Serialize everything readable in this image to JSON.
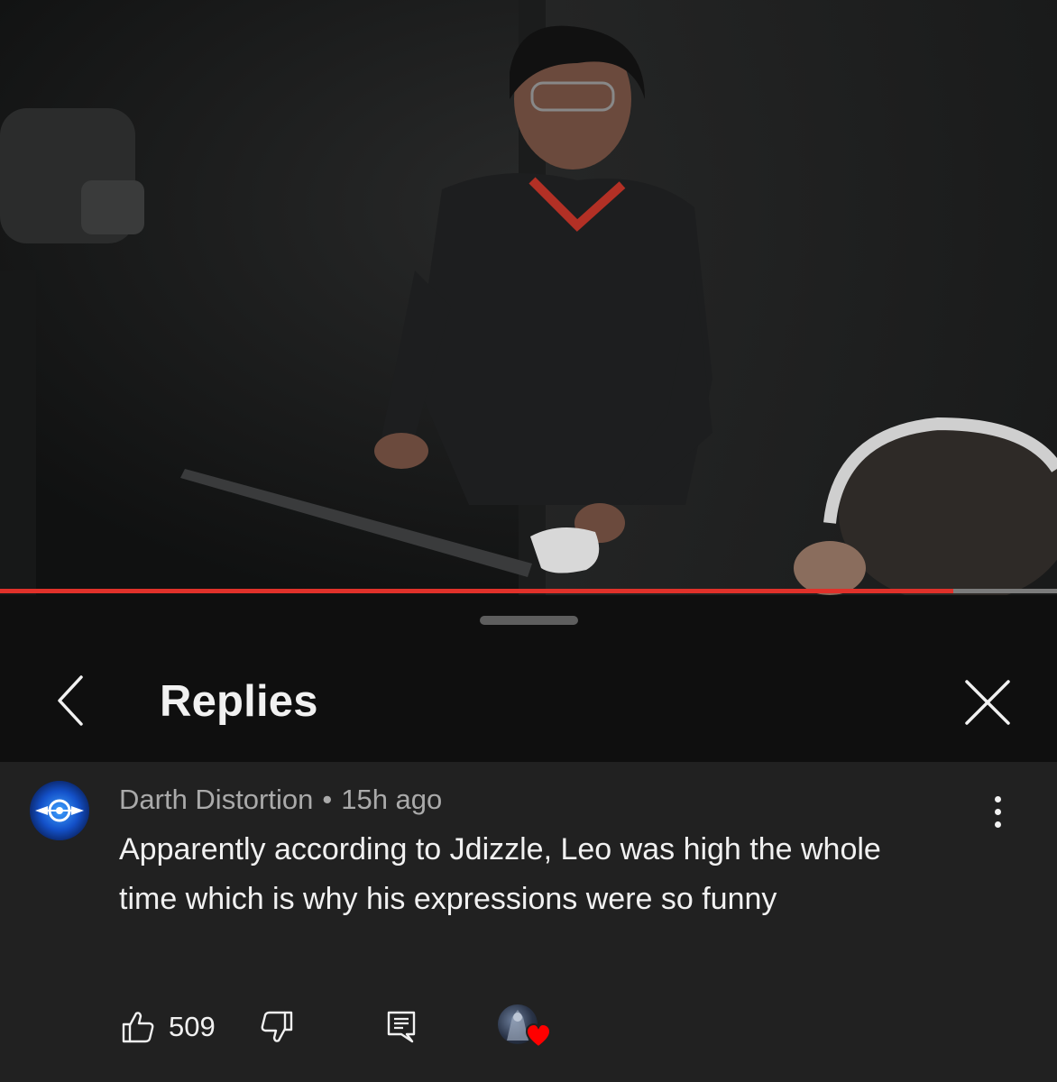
{
  "video": {
    "progress_fraction": 0.902,
    "progress_color": "#e0312a",
    "track_color": "#7c7c7c"
  },
  "panel": {
    "title": "Replies",
    "back_icon": "chevron-left-icon",
    "close_icon": "close-icon"
  },
  "comment": {
    "author": "Darth Distortion",
    "separator": "•",
    "time": "15h ago",
    "text": "Apparently according to Jdizzle, Leo was high the whole time which is why his expressions were so funny",
    "more_icon": "more-vertical-icon",
    "likes": "509",
    "like_icon": "thumbs-up-icon",
    "dislike_icon": "thumbs-down-icon",
    "reply_icon": "reply-icon",
    "creator_heart_icon": "heart-icon",
    "heart_color": "#ff0000"
  }
}
